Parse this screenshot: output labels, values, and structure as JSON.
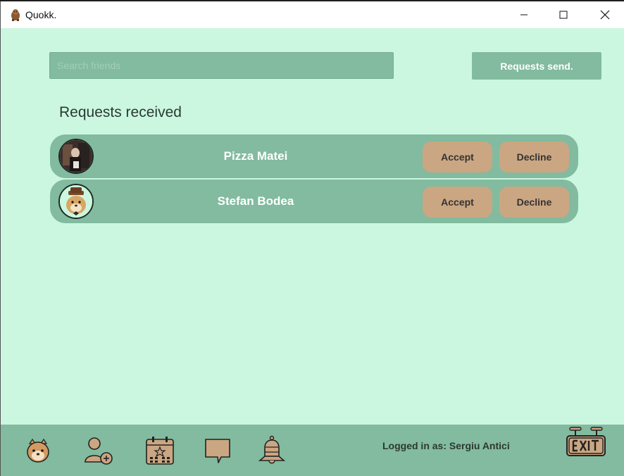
{
  "window": {
    "title": "Quokk."
  },
  "search": {
    "placeholder": "Search friends"
  },
  "requests_sent_button": "Requests send.",
  "section_title": "Requests received",
  "requests": [
    {
      "name": "Pizza Matei",
      "accept_label": "Accept",
      "decline_label": "Decline",
      "avatar": "photo-avatar"
    },
    {
      "name": "Stefan Bodea",
      "accept_label": "Accept",
      "decline_label": "Decline",
      "avatar": "quokka-hat-avatar"
    }
  ],
  "footer": {
    "nav_icons": [
      "quokka-profile-icon",
      "add-friend-icon",
      "calendar-icon",
      "chat-icon",
      "bell-icon"
    ],
    "logged_in_text": "Logged in as: Sergiu Antici",
    "exit_icon": "exit-sign-icon"
  },
  "colors": {
    "background": "#cbf7e0",
    "panel": "#82bb9f",
    "button": "#cba682",
    "text_dark": "#2c3832"
  }
}
